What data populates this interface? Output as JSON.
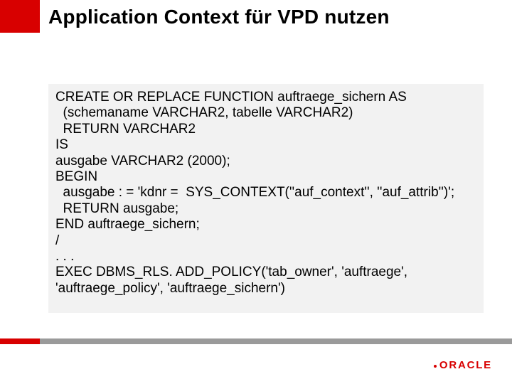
{
  "title": "Application Context für VPD nutzen",
  "code": {
    "l1": "CREATE OR REPLACE FUNCTION auftraege_sichern AS",
    "l2": "  (schemaname VARCHAR2, tabelle VARCHAR2)",
    "l3": "  RETURN VARCHAR2",
    "l4": "IS",
    "l5": "ausgabe VARCHAR2 (2000);",
    "l6": "BEGIN",
    "l7": "  ausgabe : = 'kdnr =  SYS_CONTEXT(''auf_context'', ''auf_attrib'')';",
    "l8": "  RETURN ausgabe;",
    "l9": "END auftraege_sichern;",
    "l10": "/",
    "l11": ". . .",
    "l12": "EXEC DBMS_RLS. ADD_POLICY('tab_owner', 'auftraege',",
    "l13": "'auftraege_policy', 'auftraege_sichern')"
  },
  "logo": {
    "text": "ORACLE"
  },
  "colors": {
    "accent": "#d80000",
    "codebg": "#f2f2f2",
    "stripegray": "#9a9a9a"
  }
}
